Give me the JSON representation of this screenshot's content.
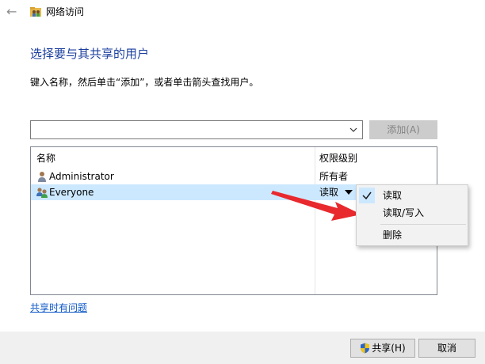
{
  "window": {
    "title": "网络访问"
  },
  "heading": "选择要与其共享的用户",
  "instruction": "键入名称，然后单击“添加”，或者单击箭头查找用户。",
  "name_input": {
    "value": ""
  },
  "add_button": "添加(A)",
  "columns": {
    "name": "名称",
    "permission": "权限级别"
  },
  "users": [
    {
      "name": "Administrator",
      "permission": "所有者",
      "icon": "user-icon"
    },
    {
      "name": "Everyone",
      "permission": "读取",
      "icon": "group-icon",
      "selected": true
    }
  ],
  "permission_menu": {
    "items": [
      {
        "label": "读取",
        "checked": true
      },
      {
        "label": "读取/写入",
        "checked": false
      },
      {
        "label": "删除",
        "checked": false
      }
    ]
  },
  "help_link": "共享时有问题",
  "footer": {
    "share_button": "共享(H)",
    "cancel_button": "取消"
  },
  "colors": {
    "heading": "#1a3e9e",
    "selection": "#cce8ff",
    "link": "#0c57c7",
    "annotation_arrow": "#e8292e"
  }
}
